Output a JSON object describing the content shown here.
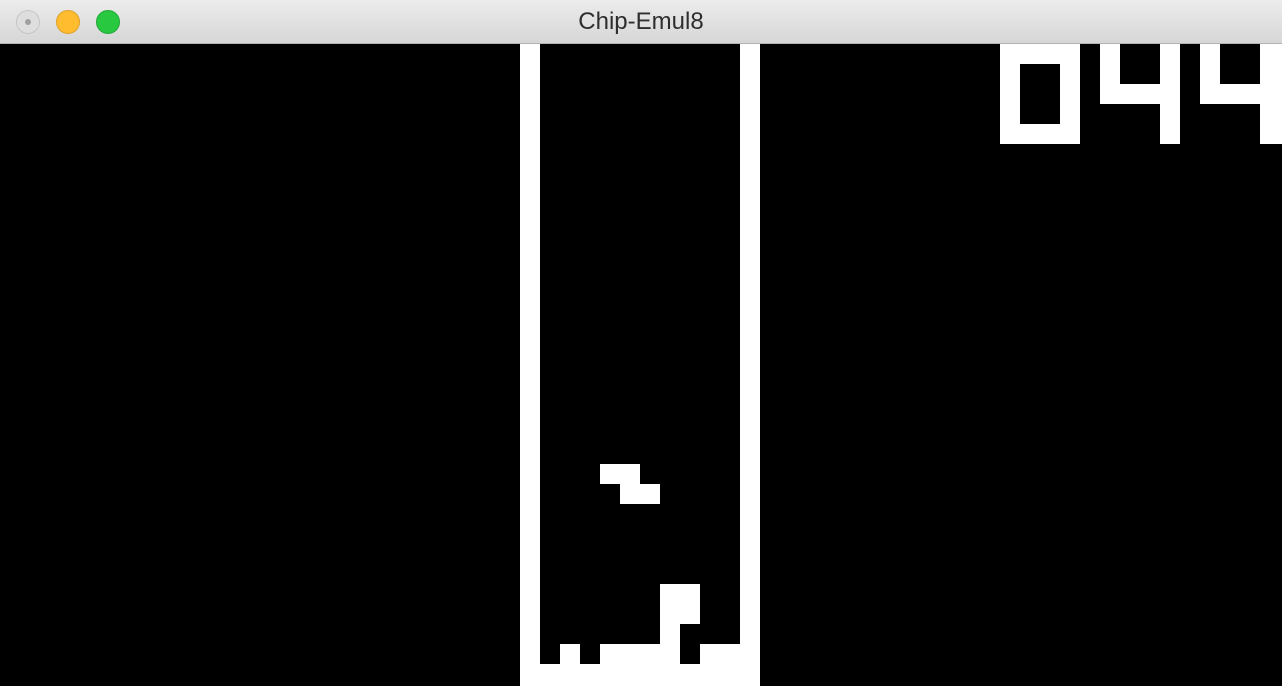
{
  "window": {
    "title": "Chip-Emul8"
  },
  "game": {
    "score_text": "044",
    "colors": {
      "background": "#000000",
      "pixel": "#ffffff"
    }
  }
}
